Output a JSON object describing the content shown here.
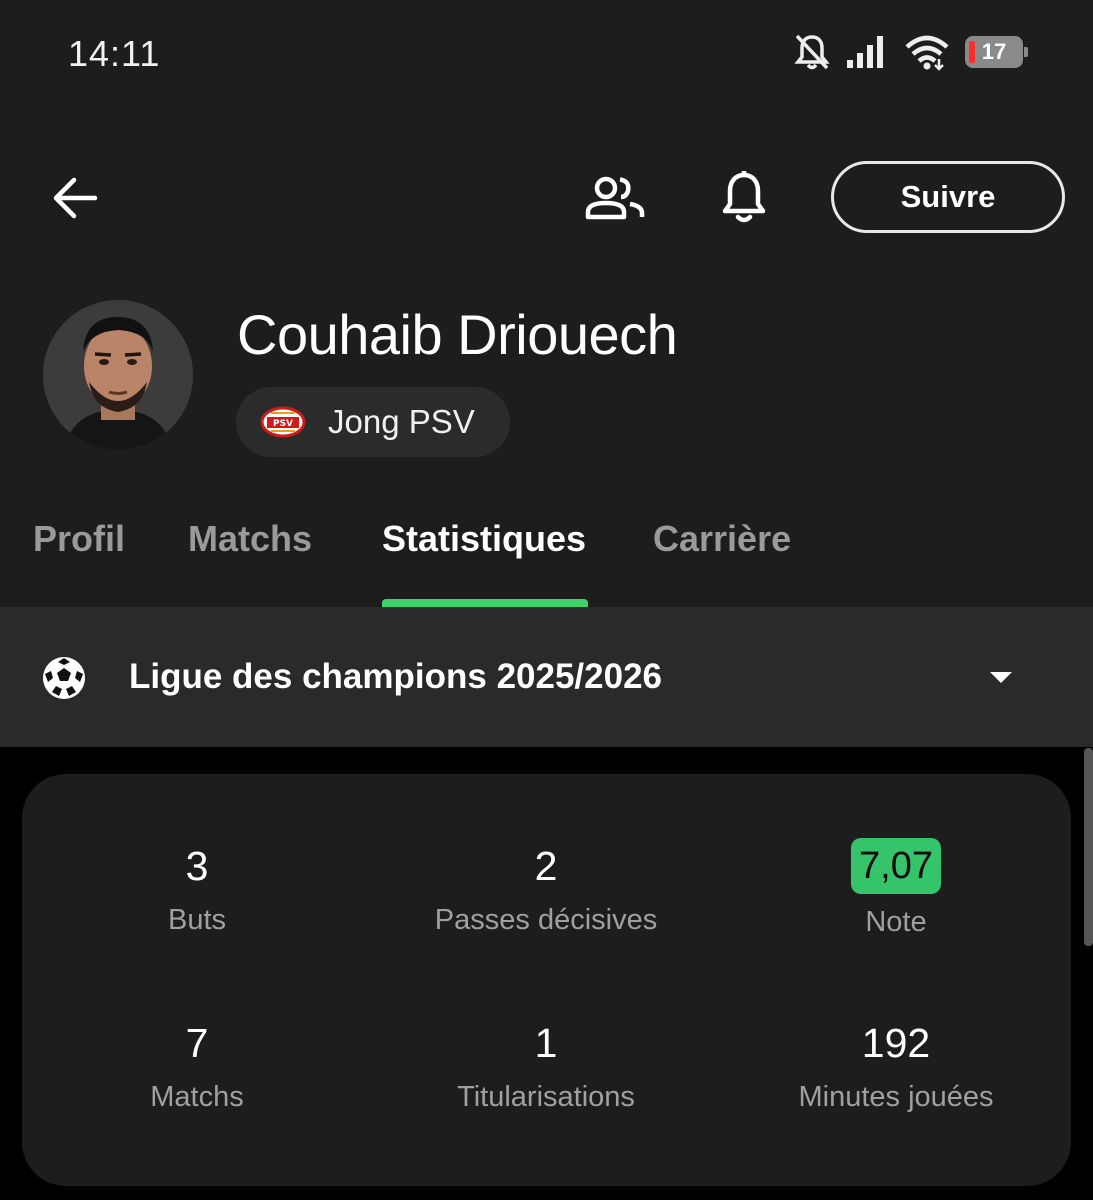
{
  "status_bar": {
    "time": "14:11",
    "battery": "17",
    "icons": [
      "bell-off-icon",
      "signal-icon",
      "wifi-icon",
      "battery-icon"
    ]
  },
  "toolbar": {
    "back_icon": "arrow-left-icon",
    "squad_icon": "people-icon",
    "notify_icon": "bell-icon",
    "follow_label": "Suivre"
  },
  "player": {
    "name": "Couhaib Driouech",
    "team": "Jong PSV"
  },
  "tabs": [
    {
      "label": "Profil",
      "active": false
    },
    {
      "label": "Matchs",
      "active": false
    },
    {
      "label": "Statistiques",
      "active": true
    },
    {
      "label": "Carrière",
      "active": false
    }
  ],
  "competition": {
    "label": "Ligue des champions 2025/2026",
    "icon": "football-icon"
  },
  "stats": [
    {
      "value": "3",
      "label": "Buts"
    },
    {
      "value": "2",
      "label": "Passes décisives"
    },
    {
      "value": "7,07",
      "label": "Note"
    },
    {
      "value": "7",
      "label": "Matchs"
    },
    {
      "value": "1",
      "label": "Titularisations"
    },
    {
      "value": "192",
      "label": "Minutes jouées"
    }
  ],
  "colors": {
    "accent": "#3fd26b",
    "rating": "#35c46a",
    "background": "#1d1d1d",
    "battery_low": "#ff2d2d"
  }
}
